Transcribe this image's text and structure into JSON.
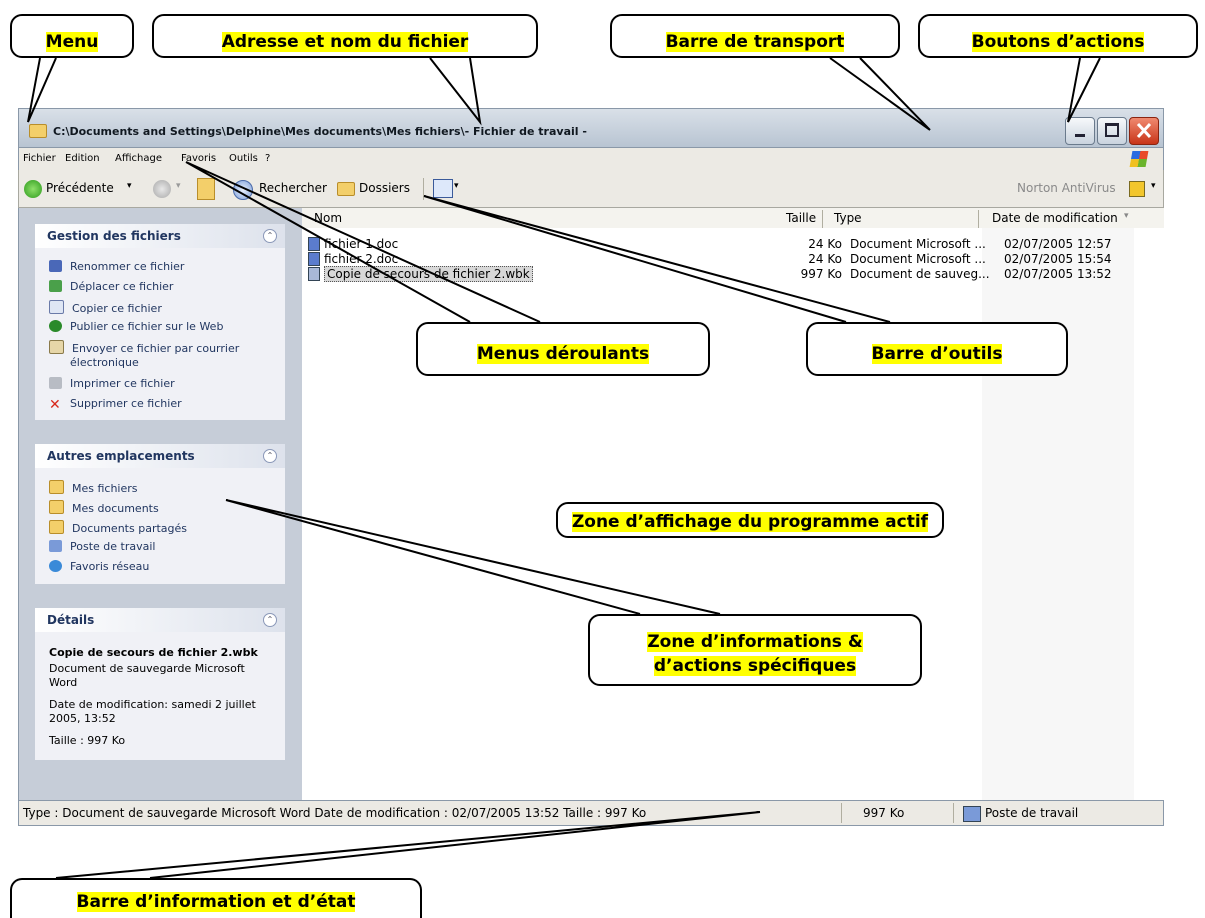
{
  "window": {
    "title": "C:\\Documents and Settings\\Delphine\\Mes documents\\Mes fichiers\\- Fichier de travail -",
    "buttons": [
      "minimize",
      "maximize",
      "close"
    ]
  },
  "menubar": {
    "items": [
      "Fichier",
      "Edition",
      "Affichage",
      "Favoris",
      "Outils",
      "?"
    ]
  },
  "toolbar": {
    "back_label": "Précédente",
    "search_label": "Rechercher",
    "folders_label": "Dossiers",
    "norton_label": "Norton AntiVirus"
  },
  "columns": {
    "name": "Nom",
    "size": "Taille",
    "type": "Type",
    "date": "Date de modification"
  },
  "files": [
    {
      "name": "fichier 1.doc",
      "size": "24 Ko",
      "type": "Document Microsoft ...",
      "date": "02/07/2005 12:57"
    },
    {
      "name": "fichier 2.doc",
      "size": "24 Ko",
      "type": "Document Microsoft ...",
      "date": "02/07/2005 15:54"
    },
    {
      "name": "Copie de secours de fichier 2.wbk",
      "size": "997 Ko",
      "type": "Document de sauveg...",
      "date": "02/07/2005 13:52",
      "selected": true
    }
  ],
  "tasks": {
    "title": "Gestion des fichiers",
    "items": [
      "Renommer ce fichier",
      "Déplacer ce fichier",
      "Copier ce fichier",
      "Publier ce fichier sur le Web",
      "Envoyer ce fichier par courrier",
      "électronique",
      "Imprimer ce fichier",
      "Supprimer ce fichier"
    ]
  },
  "places": {
    "title": "Autres emplacements",
    "items": [
      "Mes fichiers",
      "Mes documents",
      "Documents partagés",
      "Poste de travail",
      "Favoris réseau"
    ]
  },
  "details": {
    "title": "Détails",
    "filename": "Copie de secours de fichier 2.wbk",
    "doctype_line1": "Document de sauvegarde Microsoft",
    "doctype_line2": "Word",
    "modified_line1": "Date de modification: samedi 2 juillet",
    "modified_line2": "2005, 13:52",
    "size": "Taille : 997 Ko"
  },
  "statusbar": {
    "info": "Type : Document de sauvegarde Microsoft Word Date de modification : 02/07/2005 13:52 Taille : 997 Ko",
    "size": "997 Ko",
    "location": "Poste de travail"
  },
  "callouts": {
    "menu": "Menu",
    "address": "Adresse et nom du fichier",
    "transport": "Barre de transport",
    "actions": "Boutons d’actions",
    "dropdowns": "Menus déroulants",
    "toolbar": "Barre d’outils",
    "display_zone": "Zone d’affichage du programme actif",
    "info_zone_line1": "Zone d’informations &",
    "info_zone_line2": "d’actions spécifiques",
    "status_bar": "Barre d’information et d’état"
  },
  "colors": {
    "highlight": "#ffff00",
    "selection": "#d8d8d8",
    "close_button": "#d84a28",
    "sidebar_header": "#213660"
  }
}
